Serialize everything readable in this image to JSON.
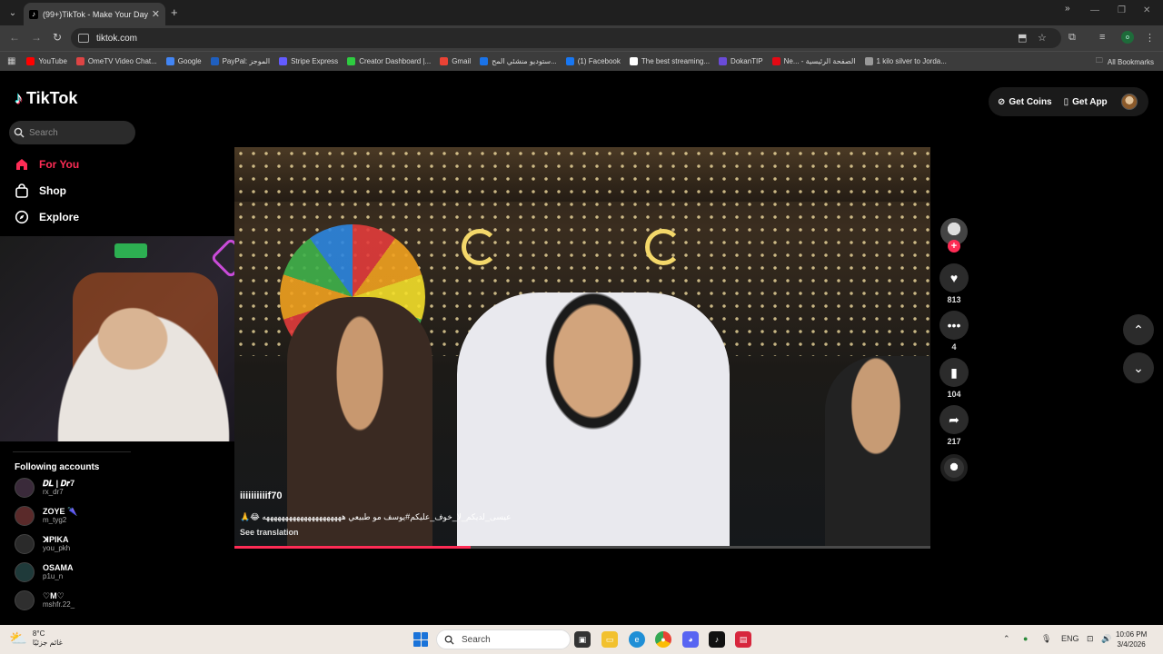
{
  "browser": {
    "tab_title": "(99+)TikTok - Make Your Day",
    "tab_favicon": "tiktok-icon",
    "url": "tiktok.com",
    "bookmarks": [
      {
        "label": "YouTube",
        "color": "#ff0000"
      },
      {
        "label": "OmeTV Video Chat...",
        "color": "#d44"
      },
      {
        "label": "Google",
        "color": "#4285f4"
      },
      {
        "label": "PayPal: الموجز",
        "color": "#1f5fbf"
      },
      {
        "label": "Stripe Express",
        "color": "#635bff"
      },
      {
        "label": "Creator Dashboard |...",
        "color": "#2ecc40"
      },
      {
        "label": "Gmail",
        "color": "#ea4335"
      },
      {
        "label": "ستوديو منشئي المح...",
        "color": "#1a73e8"
      },
      {
        "label": "(1) Facebook",
        "color": "#1877f2"
      },
      {
        "label": "The best streaming...",
        "color": "#ffffff"
      },
      {
        "label": "DokanTIP",
        "color": "#6a4bd8"
      },
      {
        "label": "Ne... - الصفحة الرئيسية",
        "color": "#e50914"
      },
      {
        "label": "1 kilo silver to Jorda...",
        "color": "#999999"
      }
    ],
    "all_bookmarks": "All Bookmarks"
  },
  "sidebar": {
    "logo": "TikTok",
    "search_placeholder": "Search",
    "nav": [
      {
        "label": "For You",
        "icon": "home-icon"
      },
      {
        "label": "Shop",
        "icon": "shop-bag-icon"
      },
      {
        "label": "Explore",
        "icon": "compass-icon"
      }
    ],
    "following_title": "Following accounts",
    "following": [
      {
        "name": "𝑫𝑳 | 𝑫𝒓7",
        "user": "rx_dr7",
        "color": "#3a2a3a"
      },
      {
        "name": "ZOYE 🌂",
        "user": "m_tyg2",
        "color": "#5a2a2a"
      },
      {
        "name": "ꓘPIKA",
        "user": "you_pkh",
        "color": "#2a2a2a"
      },
      {
        "name": "OSAMA",
        "user": "p1u_n",
        "color": "#1f3a3a"
      },
      {
        "name": "♡M♡",
        "user": "mshfr.22_",
        "color": "#2f2f2f"
      }
    ]
  },
  "header": {
    "get_coins": "Get Coins",
    "get_app": "Get App"
  },
  "video": {
    "creator": "iiiiiiiiiif70",
    "caption": "عيسى_لديكم_لا_خوف_عليكم#يوسف مو طبيعي هههههههههههههههههههههه 😂🙏",
    "see_translation": "See translation",
    "progress": 0.34
  },
  "actions": {
    "likes": "813",
    "comments": "4",
    "saves": "104",
    "shares": "217"
  },
  "taskbar": {
    "temperature": "8°C",
    "weather_text": "غائم جزئيًا",
    "search": "Search",
    "lang": "ENG",
    "time": "10:06 PM",
    "date": "3/4/2026"
  }
}
